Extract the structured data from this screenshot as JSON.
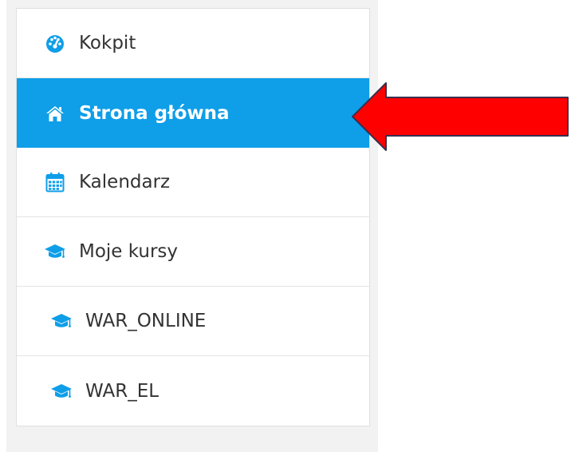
{
  "nav": {
    "items": [
      {
        "label": "Kokpit",
        "icon": "dashboard-icon",
        "active": false
      },
      {
        "label": "Strona główna",
        "icon": "home-icon",
        "active": true
      },
      {
        "label": "Kalendarz",
        "icon": "calendar-icon",
        "active": false
      },
      {
        "label": "Moje kursy",
        "icon": "graduation-cap-icon",
        "active": false
      },
      {
        "label": "WAR_ONLINE",
        "icon": "graduation-cap-icon",
        "active": false
      },
      {
        "label": "WAR_EL",
        "icon": "graduation-cap-icon",
        "active": false
      }
    ]
  },
  "colors": {
    "accent": "#0f9ee8",
    "arrow": "#ff0000",
    "drawer_background": "#f2f2f2"
  }
}
